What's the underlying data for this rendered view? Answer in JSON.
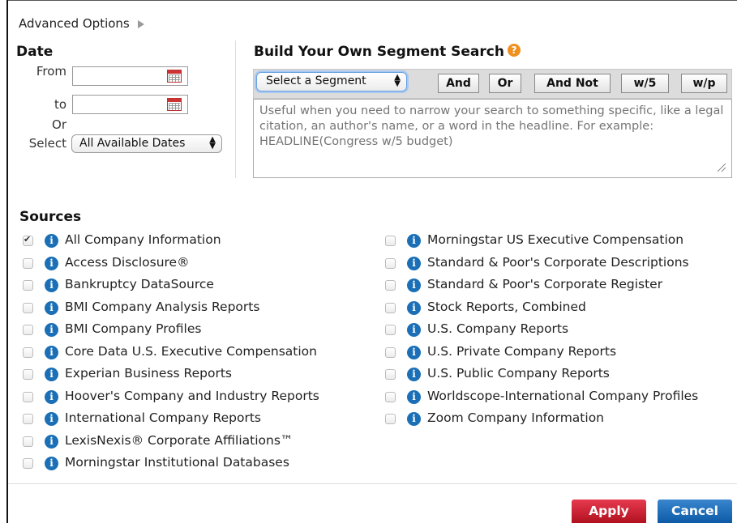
{
  "advanced_options": {
    "label": "Advanced Options"
  },
  "date": {
    "heading": "Date",
    "from_label": "From",
    "to_label": "to",
    "or_label": "Or",
    "select_label": "Select",
    "from_value": "",
    "to_value": "",
    "selected_range": "All Available Dates"
  },
  "segment": {
    "heading": "Build Your Own Segment Search",
    "help_glyph": "?",
    "select_value": "Select a Segment",
    "operators": [
      "And",
      "Or",
      "And Not",
      "w/5",
      "w/p"
    ],
    "placeholder": "Useful when you need to narrow your search to something specific, like a legal citation, an author's name, or a word in the headline. For example: HEADLINE(Congress w/5 budget)"
  },
  "sources": {
    "heading": "Sources",
    "left": [
      {
        "label": "All Company Information",
        "checked": true
      },
      {
        "label": "Access Disclosure®",
        "checked": false
      },
      {
        "label": "Bankruptcy DataSource",
        "checked": false
      },
      {
        "label": "BMI Company Analysis Reports",
        "checked": false
      },
      {
        "label": "BMI Company Profiles",
        "checked": false
      },
      {
        "label": "Core Data U.S. Executive Compensation",
        "checked": false
      },
      {
        "label": "Experian Business Reports",
        "checked": false
      },
      {
        "label": "Hoover's Company and Industry Reports",
        "checked": false
      },
      {
        "label": "International Company Reports",
        "checked": false
      },
      {
        "label": "LexisNexis® Corporate Affiliations™",
        "checked": false
      },
      {
        "label": "Morningstar Institutional Databases",
        "checked": false
      }
    ],
    "right": [
      {
        "label": "Morningstar US Executive Compensation",
        "checked": false
      },
      {
        "label": "Standard & Poor's Corporate Descriptions",
        "checked": false
      },
      {
        "label": "Standard & Poor's Corporate Register",
        "checked": false
      },
      {
        "label": "Stock Reports, Combined",
        "checked": false
      },
      {
        "label": "U.S. Company Reports",
        "checked": false
      },
      {
        "label": "U.S. Private Company Reports",
        "checked": false
      },
      {
        "label": "U.S. Public Company Reports",
        "checked": false
      },
      {
        "label": "Worldscope-International Company Profiles",
        "checked": false
      },
      {
        "label": "Zoom Company Information",
        "checked": false
      }
    ]
  },
  "actions": {
    "apply": "Apply",
    "cancel": "Cancel"
  },
  "colors": {
    "apply": "#c8172a",
    "cancel": "#1a6fb6",
    "info_icon": "#1a6fb6",
    "help_icon": "#f0901e"
  }
}
